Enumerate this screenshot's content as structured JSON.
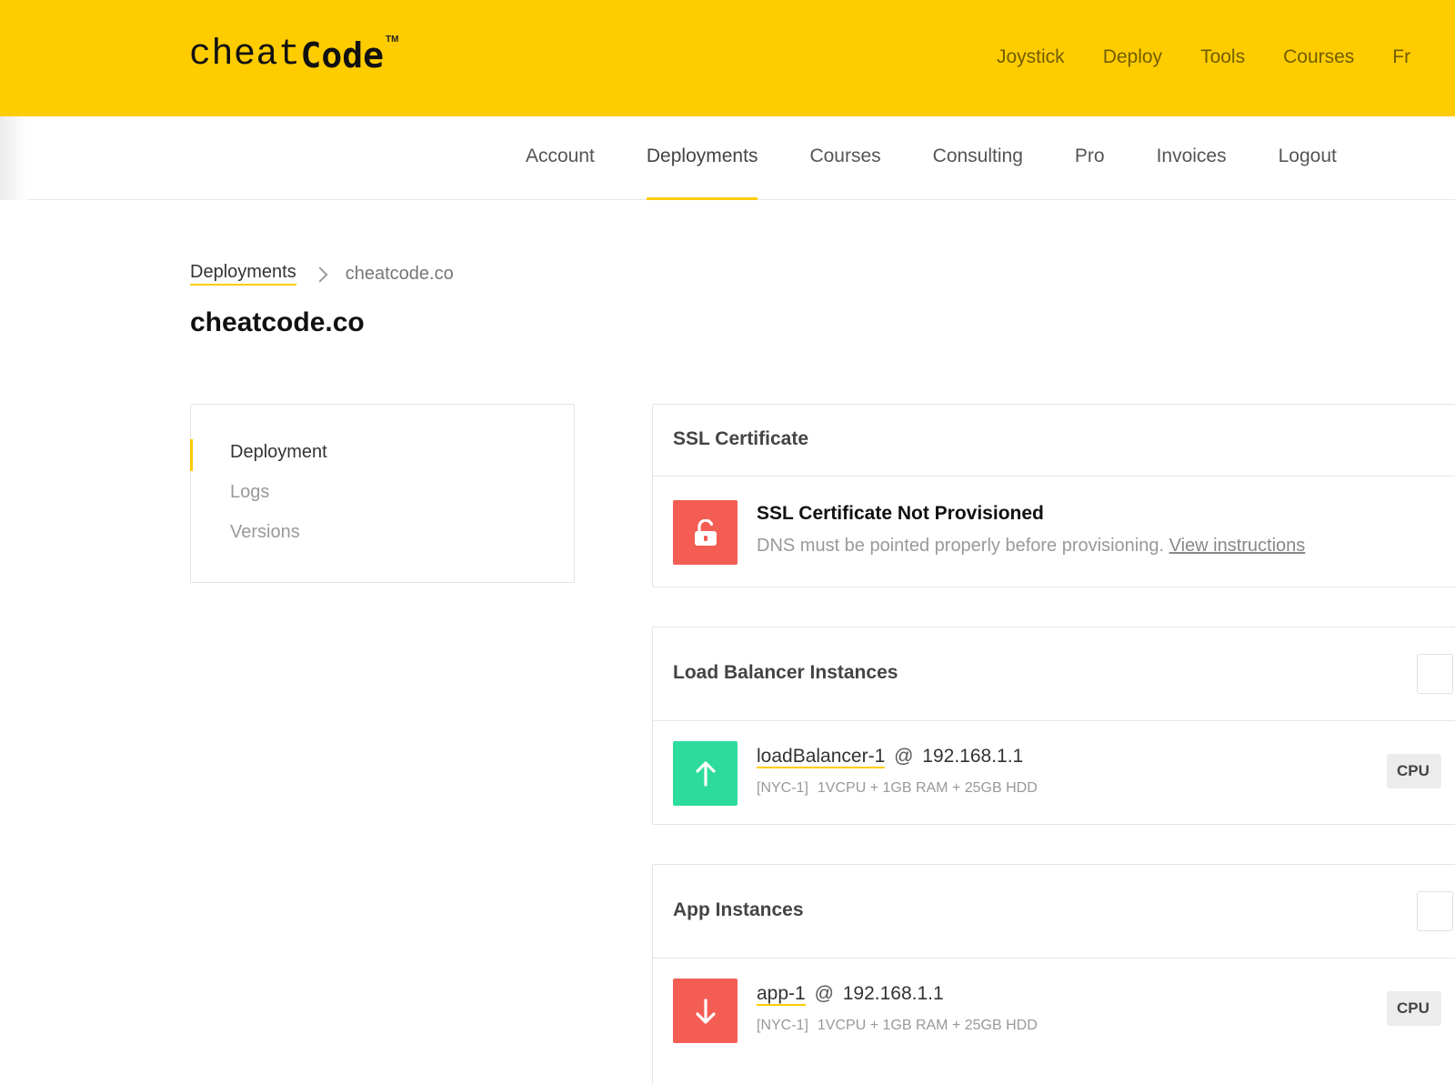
{
  "brand": {
    "logo_light": "cheat",
    "logo_bold": "Code",
    "logo_tm": "TM"
  },
  "top_nav": [
    "Joystick",
    "Deploy",
    "Tools",
    "Courses",
    "Fr"
  ],
  "sub_nav": {
    "items": [
      "Account",
      "Deployments",
      "Courses",
      "Consulting",
      "Pro",
      "Invoices",
      "Logout"
    ],
    "active": "Deployments"
  },
  "breadcrumb": {
    "parent": "Deployments",
    "current": "cheatcode.co"
  },
  "page_title": "cheatcode.co",
  "sidebar": {
    "items": [
      "Deployment",
      "Logs",
      "Versions"
    ],
    "active": "Deployment"
  },
  "ssl_panel": {
    "title": "SSL Certificate",
    "status_title": "SSL Certificate Not Provisioned",
    "status_desc": "DNS must be pointed properly before provisioning.",
    "link_text": "View instructions",
    "status_icon": "unlocked-lock-icon",
    "status_color": "#f45d54"
  },
  "lb_panel": {
    "title": "Load Balancer Instances",
    "instance": {
      "name": "loadBalancer-1",
      "at": "@",
      "ip": "192.168.1.1",
      "region": "[NYC-1]",
      "specs": "1VCPU + 1GB RAM + 25GB HDD",
      "badge": "CPU",
      "status_icon": "arrow-up-icon",
      "status_color": "#2ddc9c"
    }
  },
  "app_panel": {
    "title": "App Instances",
    "instance": {
      "name": "app-1",
      "at": "@",
      "ip": "192.168.1.1",
      "region": "[NYC-1]",
      "specs": "1VCPU + 1GB RAM + 25GB HDD",
      "badge": "CPU",
      "status_icon": "arrow-down-icon",
      "status_color": "#f45d54"
    }
  },
  "colors": {
    "brand_yellow": "#ffcc00",
    "danger": "#f45d54",
    "success": "#2ddc9c"
  }
}
